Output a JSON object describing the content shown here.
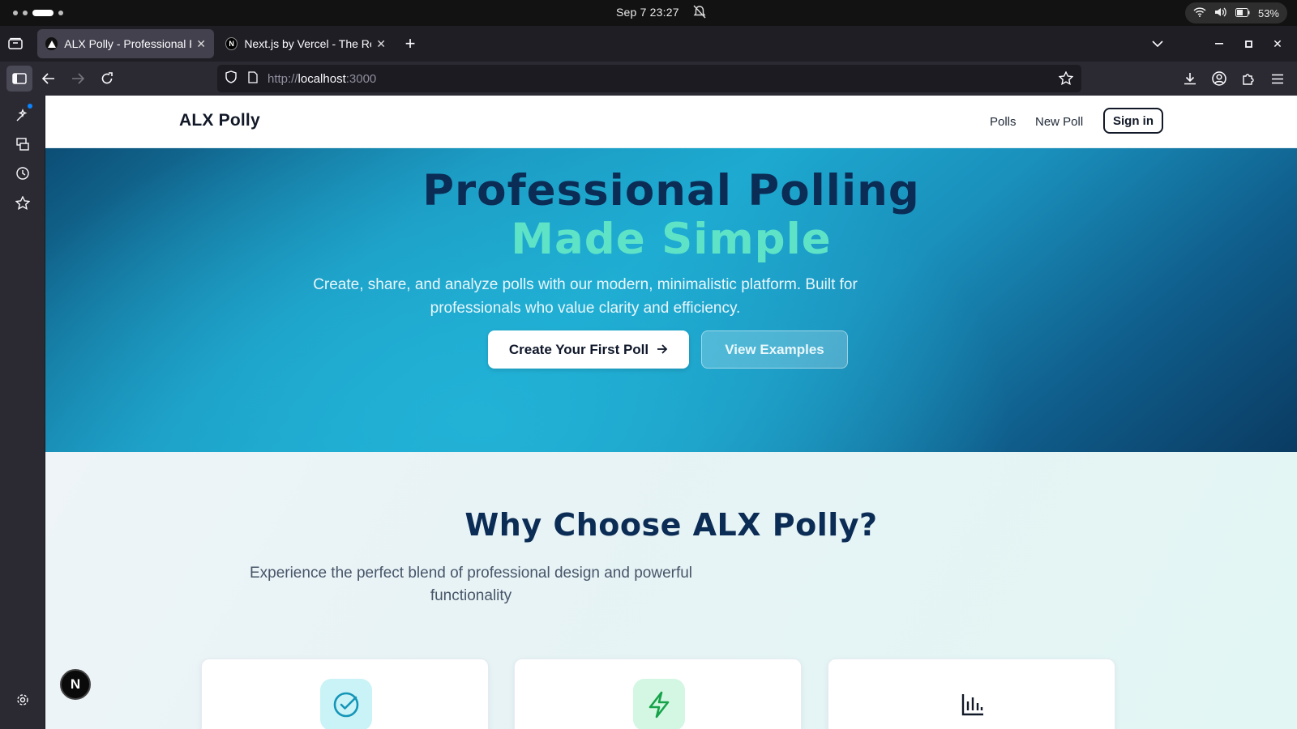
{
  "os": {
    "clock": "Sep 7  23:27",
    "battery": "53%"
  },
  "browser": {
    "tabs": [
      {
        "title": "ALX Polly - Professional P",
        "active": true
      },
      {
        "title": "Next.js by Vercel - The Re",
        "active": false
      }
    ],
    "favicon_next": "N",
    "url_prefix": "http://",
    "url_host": "localhost",
    "url_port": ":3000"
  },
  "site": {
    "brand": "ALX Polly",
    "nav": {
      "polls": "Polls",
      "new_poll": "New Poll",
      "sign_in": "Sign in"
    },
    "hero": {
      "title_line1": "Professional Polling",
      "title_line2": "Made Simple",
      "subtitle": "Create, share, and analyze polls with our modern, minimalistic platform. Built for professionals who value clarity and efficiency.",
      "primary_cta": "Create Your First Poll",
      "secondary_cta": "View Examples"
    },
    "features": {
      "title": "Why Choose ALX Polly?",
      "subtitle": "Experience the perfect blend of professional design and powerful functionality",
      "cards": [
        {
          "icon": "check-circle-icon",
          "icon_bg": "#c9f3f7",
          "icon_color": "#1595b7"
        },
        {
          "icon": "lightning-icon",
          "icon_bg": "#d3f7e3",
          "icon_color": "#16a34a"
        },
        {
          "icon": "bar-chart-icon",
          "icon_bg": "#ffffff",
          "icon_color": "#111827"
        }
      ]
    },
    "dev_badge": "N"
  },
  "colors": {
    "hero_title": "#0b2c55",
    "hero_accent": "#5fe3c7",
    "hero_bg": "#1da9d0"
  }
}
